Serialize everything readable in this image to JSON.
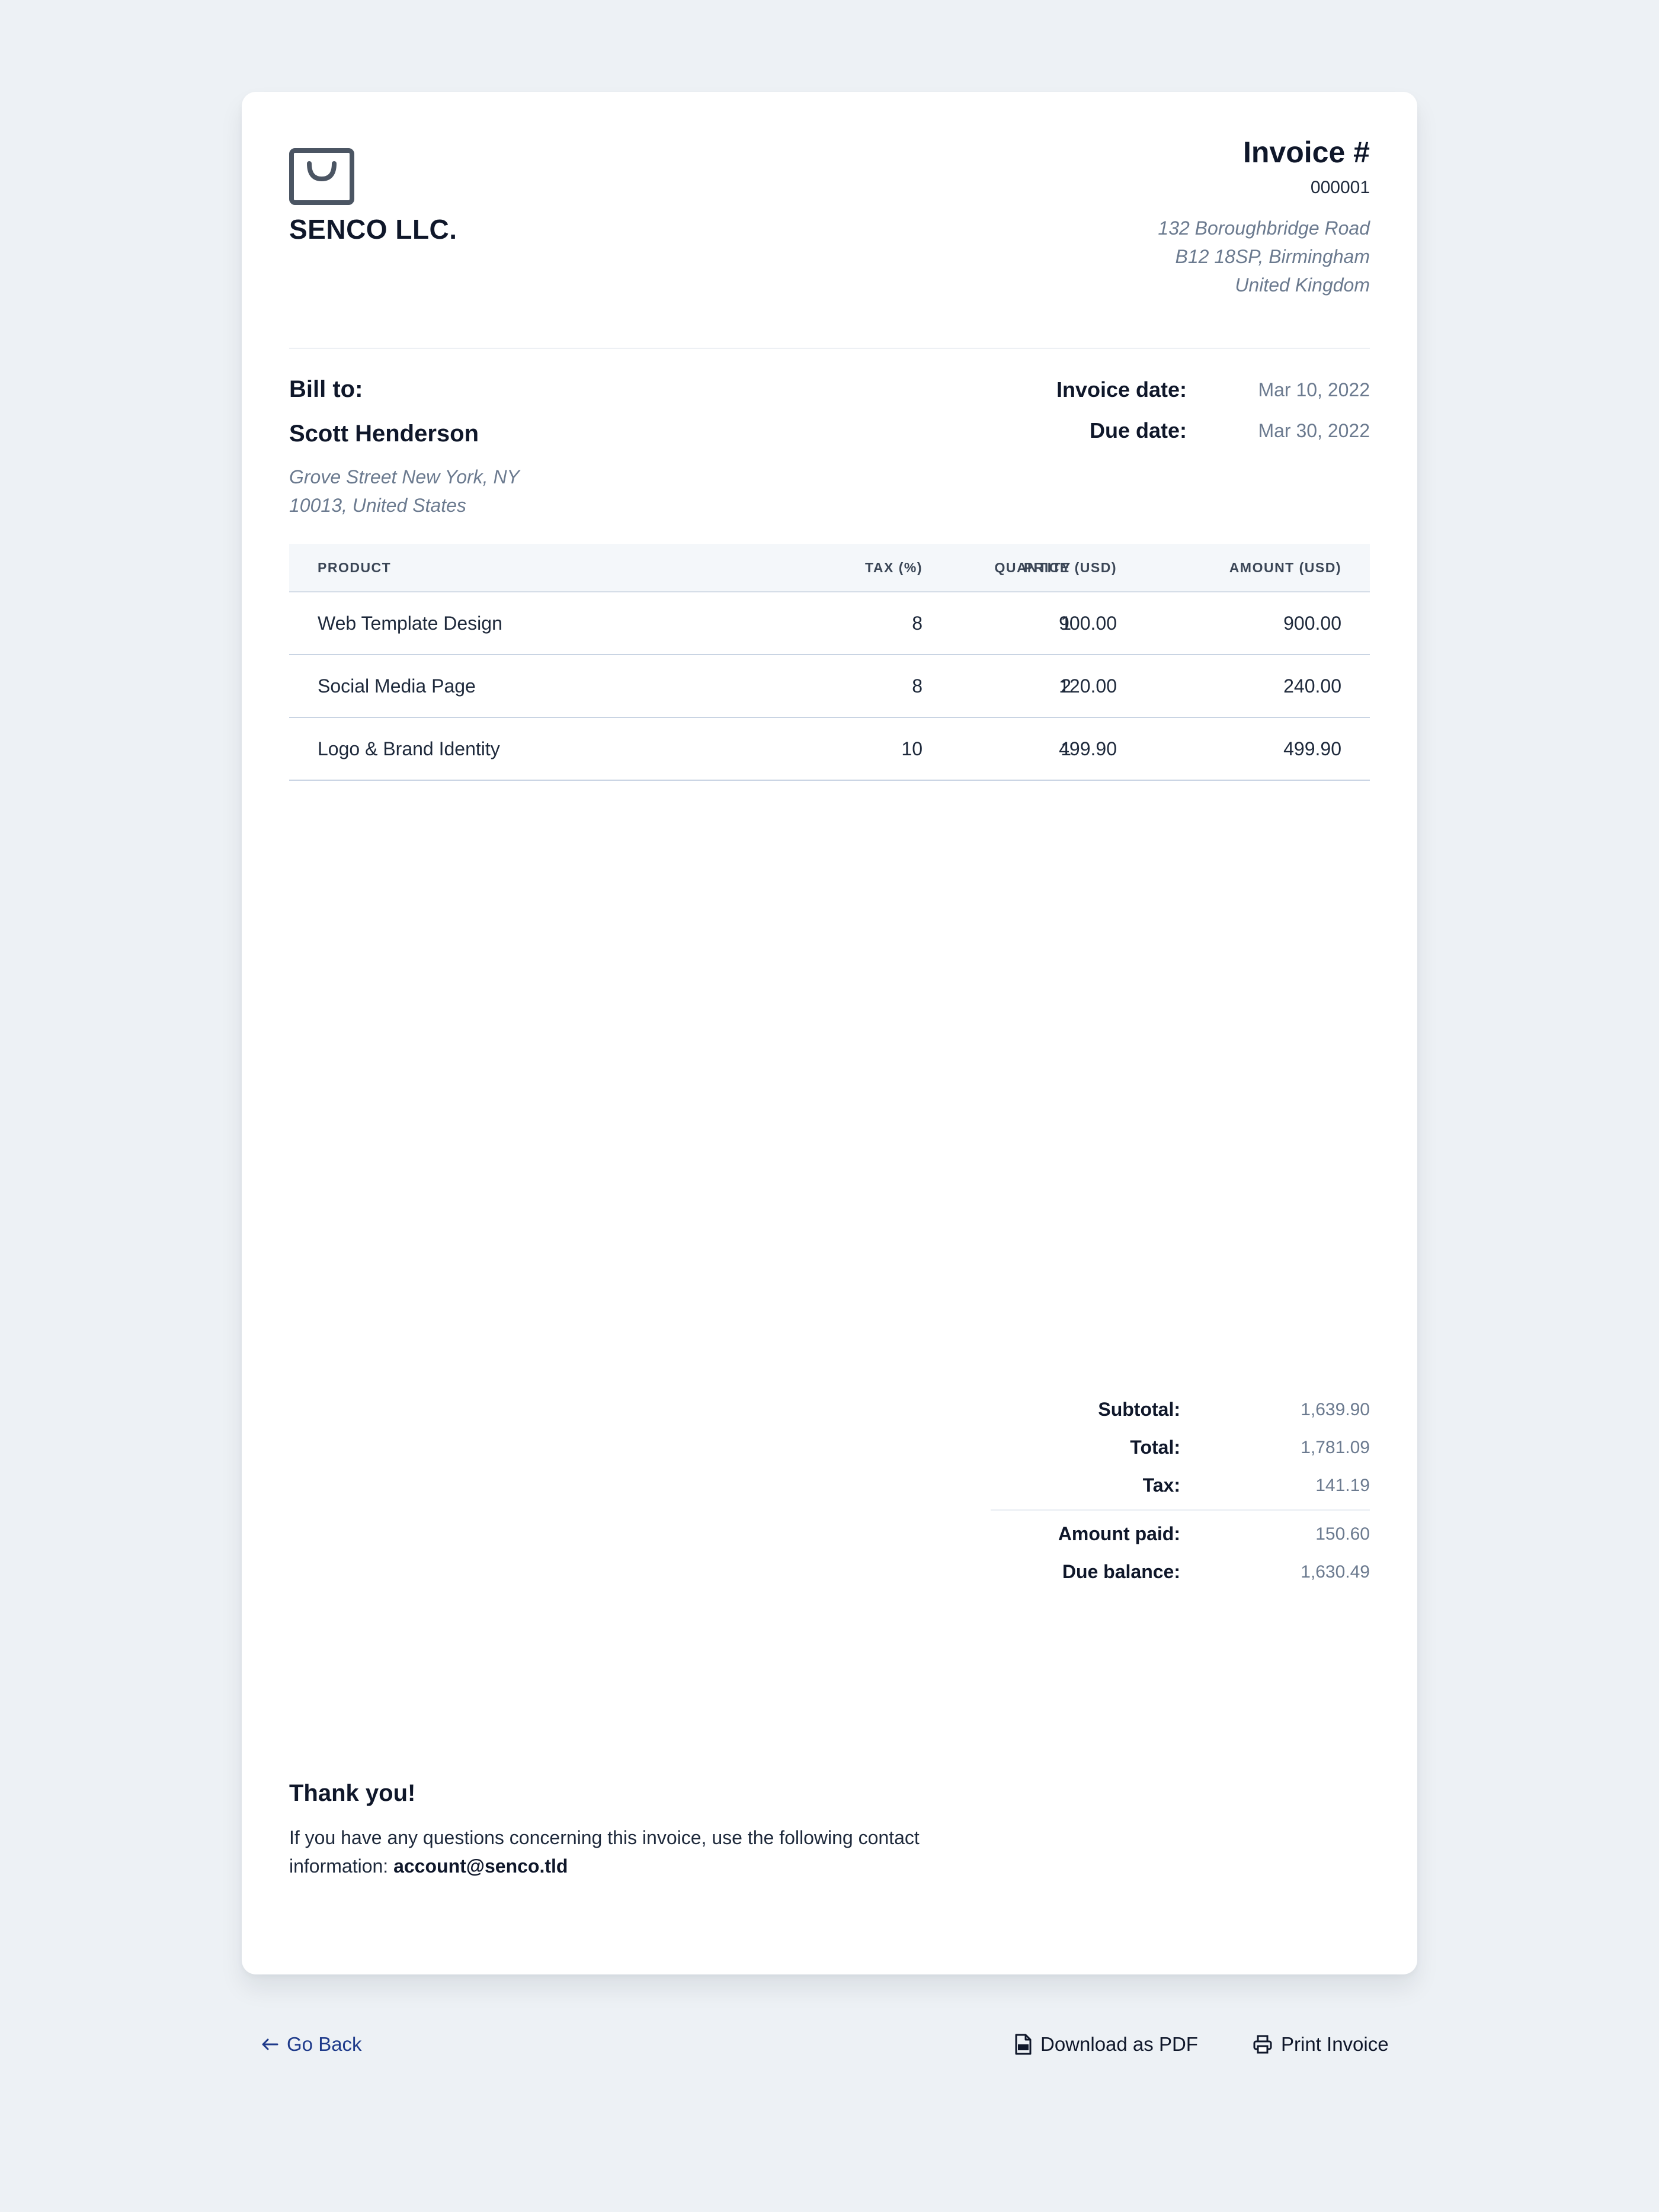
{
  "company": {
    "name": "SENCO LLC.",
    "logo_icon": "shopping-bag-icon"
  },
  "invoice": {
    "title": "Invoice #",
    "number": "000001",
    "address": [
      "132 Boroughbridge Road",
      "B12 18SP, Birmingham",
      "United Kingdom"
    ]
  },
  "bill_to": {
    "label": "Bill to:",
    "name": "Scott Henderson",
    "address": [
      "Grove Street New York, NY",
      "10013, United States"
    ]
  },
  "dates": {
    "invoice_label": "Invoice date:",
    "invoice_value": "Mar 10, 2022",
    "due_label": "Due date:",
    "due_value": "Mar 30, 2022"
  },
  "table": {
    "headers": [
      "PRODUCT",
      "QUANTITY",
      "TAX (%)",
      "PRICE (USD)",
      "AMOUNT (USD)"
    ],
    "rows": [
      {
        "product": "Web Template Design",
        "quantity": "1",
        "tax": "8",
        "price": "900.00",
        "amount": "900.00"
      },
      {
        "product": "Social Media Page",
        "quantity": "2",
        "tax": "8",
        "price": "120.00",
        "amount": "240.00"
      },
      {
        "product": "Logo & Brand Identity",
        "quantity": "1",
        "tax": "10",
        "price": "499.90",
        "amount": "499.90"
      }
    ]
  },
  "totals": {
    "subtotal_label": "Subtotal:",
    "subtotal": "1,639.90",
    "total_label": "Total:",
    "total": "1,781.09",
    "tax_label": "Tax:",
    "tax": "141.19",
    "paid_label": "Amount paid:",
    "paid": "150.60",
    "due_label": "Due balance:",
    "due": "1,630.49"
  },
  "thanks": {
    "title": "Thank you!",
    "text": "If you have any questions concerning this invoice, use the following contact information:",
    "email": "account@senco.tld"
  },
  "actions": {
    "go_back": "Go Back",
    "download": "Download as PDF",
    "print": "Print Invoice"
  },
  "colors": {
    "background": "#edf1f5",
    "card": "#ffffff",
    "text_primary": "#0f172a",
    "text_muted": "#6b7a8f",
    "link": "#1e3a8a",
    "table_header_bg": "#f4f7fa"
  }
}
